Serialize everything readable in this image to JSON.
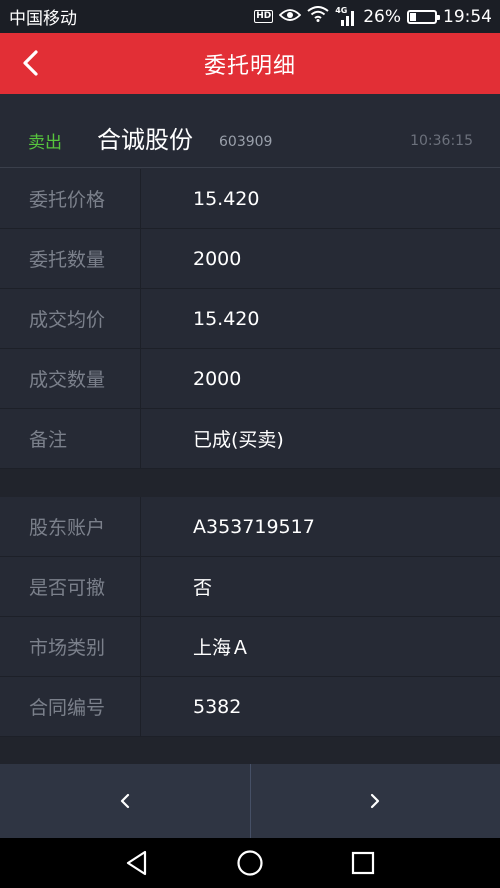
{
  "status_bar": {
    "carrier": "中国移动",
    "hd": "HD",
    "network": "4G",
    "battery_percent": "26%",
    "battery_level": 0.26,
    "time": "19:54"
  },
  "header": {
    "title": "委托明细"
  },
  "order": {
    "side": "卖出",
    "stock_name": "合诚股份",
    "stock_code": "603909",
    "time": "10:36:15",
    "side_color": "#57c53d"
  },
  "details": [
    {
      "label": "委托价格",
      "value": "15.420"
    },
    {
      "label": "委托数量",
      "value": "2000"
    },
    {
      "label": "成交均价",
      "value": "15.420"
    },
    {
      "label": "成交数量",
      "value": "2000"
    },
    {
      "label": "备注",
      "value": "已成(买卖)"
    }
  ],
  "account": [
    {
      "label": "股东账户",
      "value": "A353719517"
    },
    {
      "label": "是否可撤",
      "value": "否"
    },
    {
      "label": "市场类别",
      "value": "上海Ａ"
    },
    {
      "label": "合同编号",
      "value": "5382"
    }
  ],
  "colors": {
    "accent": "#e22f36",
    "background": "#262a35"
  }
}
